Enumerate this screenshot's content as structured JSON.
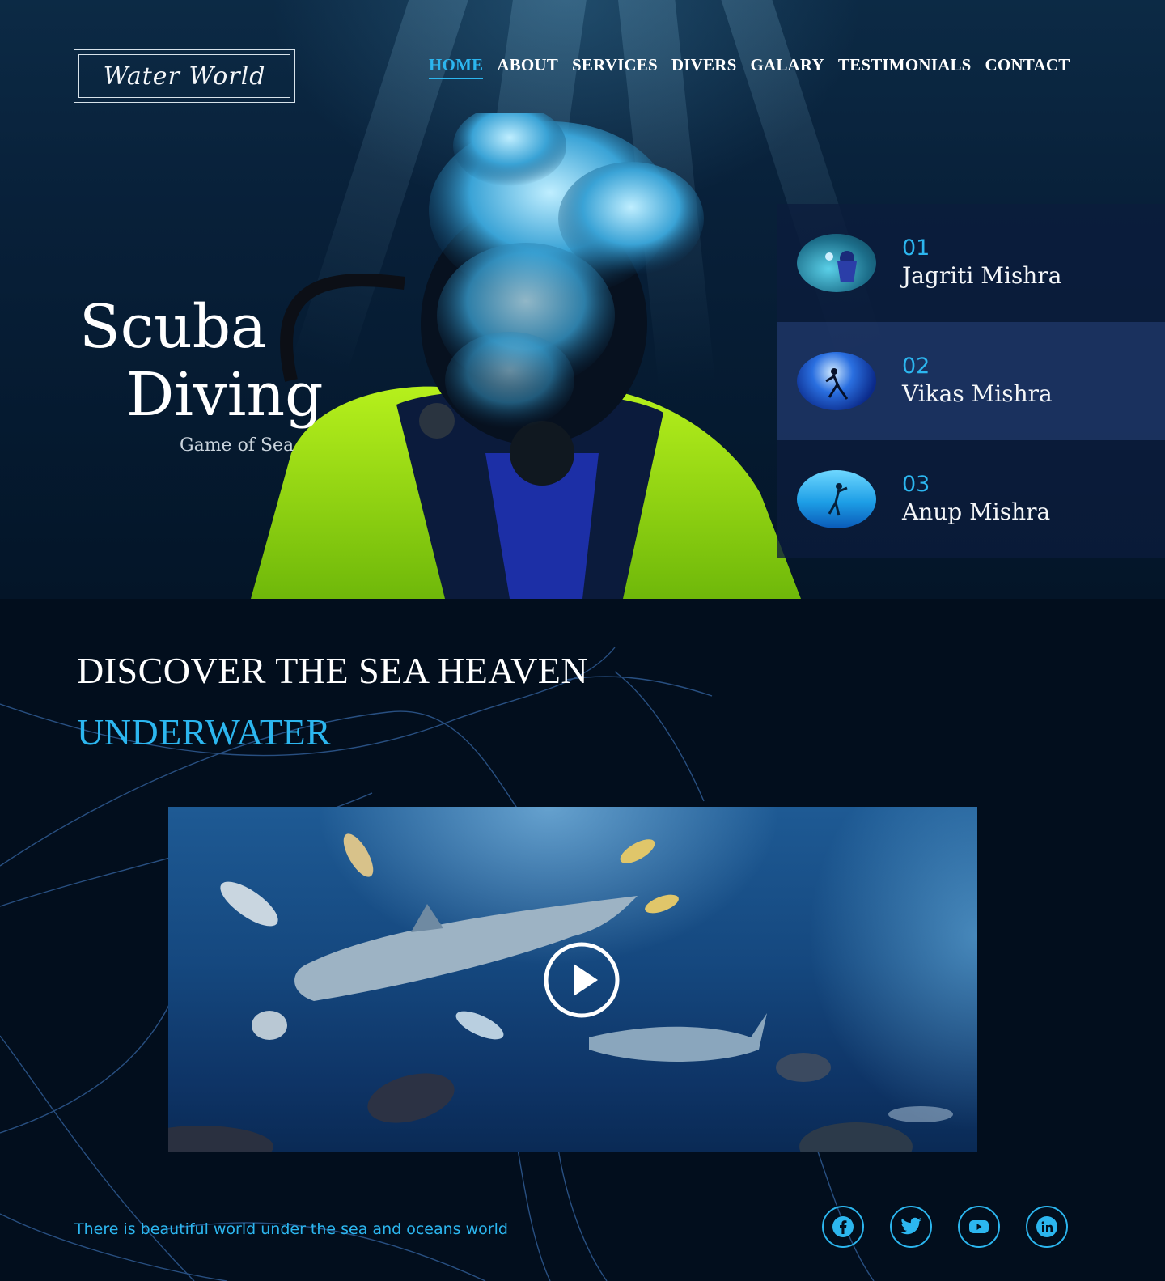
{
  "brand": {
    "logo_text": "Water World"
  },
  "nav": {
    "items": [
      {
        "label": "HOME",
        "active": true
      },
      {
        "label": "ABOUT"
      },
      {
        "label": "SERVICES"
      },
      {
        "label": "DIVERS"
      },
      {
        "label": "GALARY"
      },
      {
        "label": "TESTIMONIALS"
      },
      {
        "label": "CONTACT"
      }
    ]
  },
  "hero": {
    "title_line1": "Scuba",
    "title_line2": "Diving",
    "subtitle": "Game of Sea"
  },
  "divers": [
    {
      "number": "01",
      "name": "Jagriti Mishra",
      "thumb_icon": "diver-photo-icon"
    },
    {
      "number": "02",
      "name": "Vikas Mishra",
      "thumb_icon": "diver-silhouette-icon"
    },
    {
      "number": "03",
      "name": "Anup Mishra",
      "thumb_icon": "diver-swimming-icon"
    }
  ],
  "discover": {
    "title": "DISCOVER THE SEA HEAVEN",
    "subtitle": "UNDERWATER"
  },
  "video": {
    "play_icon": "play-icon"
  },
  "footer": {
    "tagline": "There is beautiful world under the sea and oceans world",
    "social": [
      "facebook-icon",
      "twitter-icon",
      "youtube-icon",
      "linkedin-icon"
    ]
  },
  "colors": {
    "accent": "#2cb6ef",
    "background": "#020e1d",
    "hero_top": "#0c2a45",
    "suit_green": "#9cdb12"
  }
}
